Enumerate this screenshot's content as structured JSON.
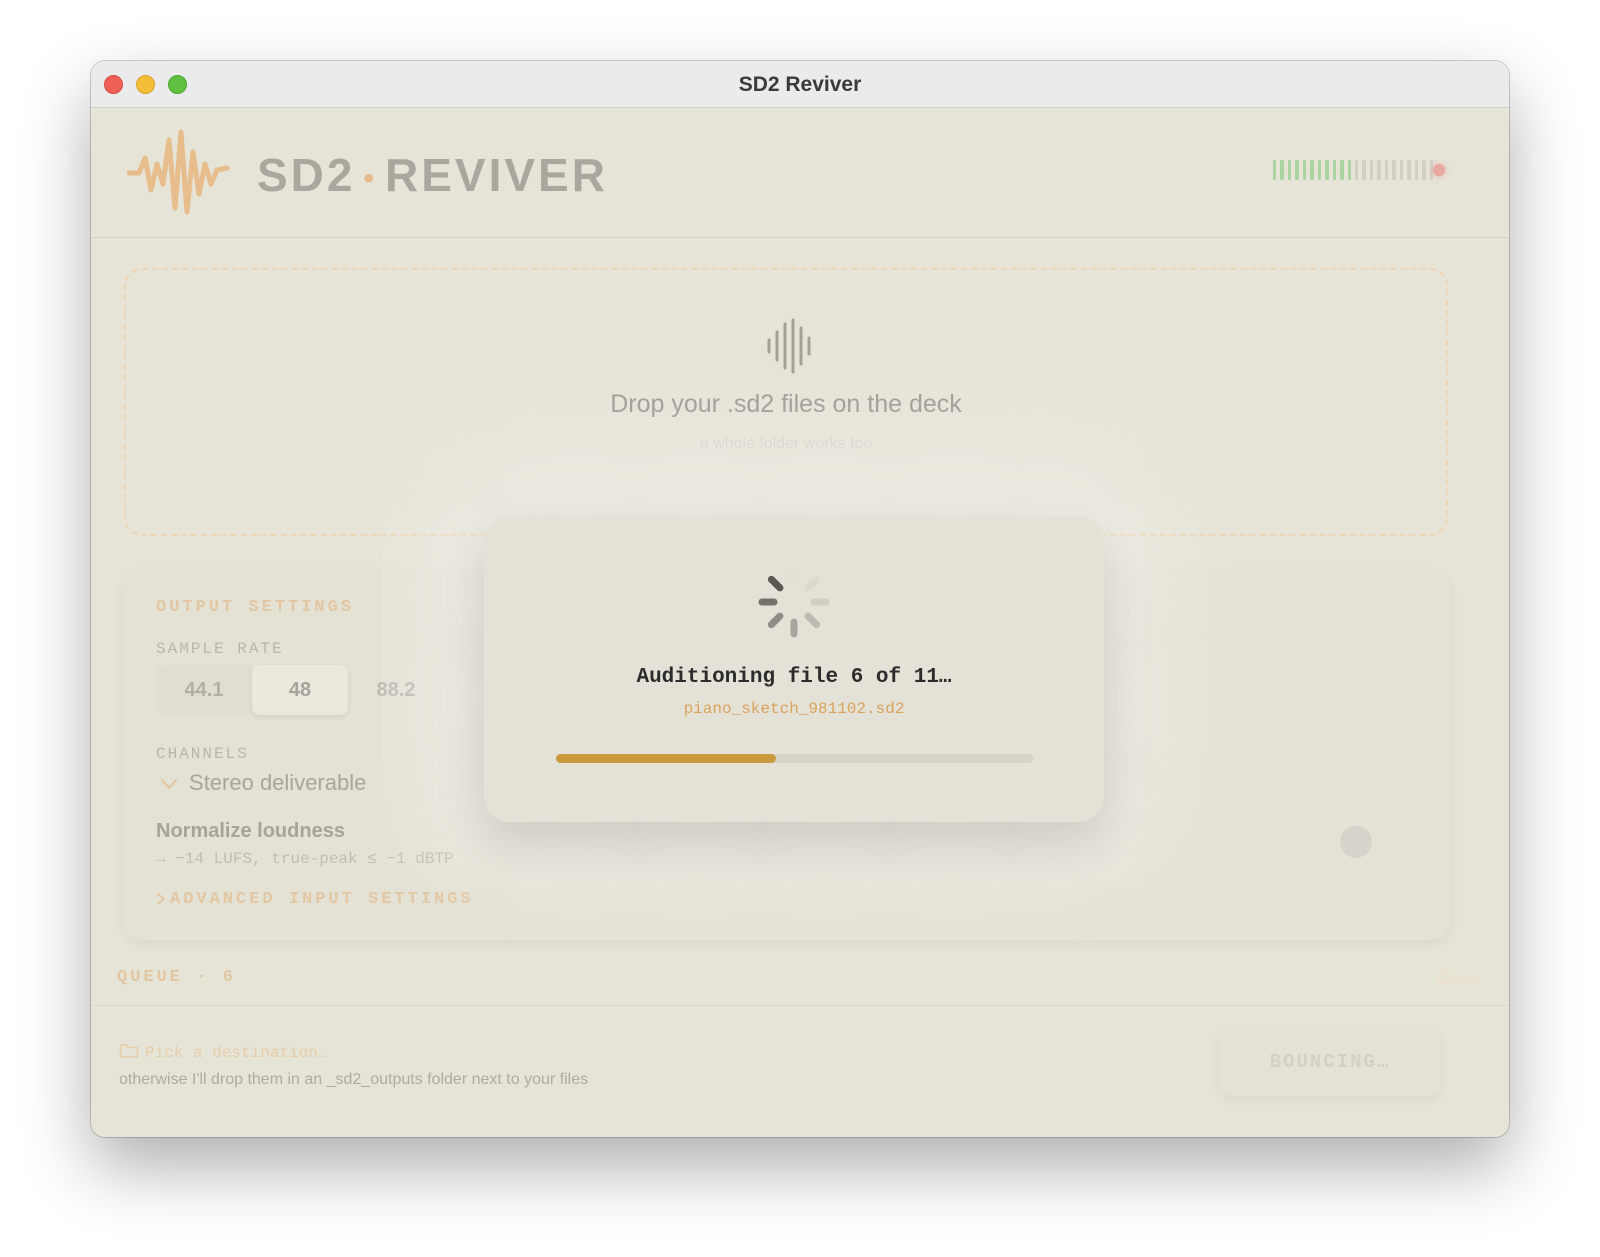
{
  "window": {
    "title": "SD2 Reviver"
  },
  "header": {
    "brand_left": "SD2",
    "brand_sep": "•",
    "brand_right": "REVIVER",
    "meter_level": 0.5
  },
  "dropzone": {
    "title": "Drop your .sd2 files on the deck",
    "subtitle": "a whole folder works too"
  },
  "settings": {
    "section_title": "OUTPUT SETTINGS",
    "sample_rate_label": "SAMPLE RATE",
    "sample_rates": [
      "44.1",
      "48",
      "88.2"
    ],
    "selected_sample_rate": "48",
    "channels_label": "CHANNELS",
    "channels_value": "Stereo deliverable",
    "normalize_title": "Normalize loudness",
    "normalize_sub": "→ −14 LUFS, true-peak ≤ −1 dBTP",
    "normalize_enabled": false,
    "advanced_label": "ADVANCED INPUT SETTINGS"
  },
  "queue": {
    "label": "QUEUE · 6",
    "clear_label": "Clear"
  },
  "footer": {
    "destination_label": "Pick a destination…",
    "destination_note": "otherwise I'll drop them in an _sd2_outputs folder next to your files",
    "bounce_label": "BOUNCING…"
  },
  "modal": {
    "title": "Auditioning file 6 of 11…",
    "filename": "piano_sketch_981102.sd2",
    "progress": 0.46
  },
  "colors": {
    "accent": "#c99a3c",
    "accent_light": "#e3c7a2",
    "background": "#e6e3d7"
  },
  "icons": {
    "logo": "waveform-logo",
    "drop": "waveform-icon",
    "folder": "folder-icon",
    "spinner": "spinner-icon",
    "chevron_down": "chevron-down-icon",
    "chevron_right": "chevron-right-icon"
  }
}
